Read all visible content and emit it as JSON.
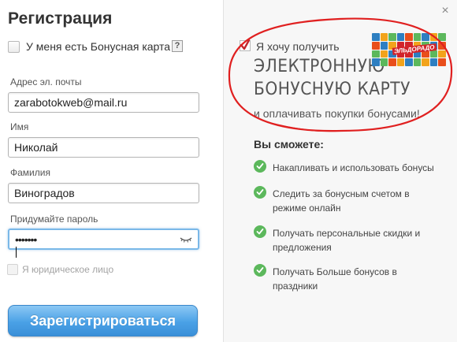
{
  "dialog": {
    "title": "Регистрация",
    "bonus_card_label": "У меня есть Бонусная карта",
    "help_badge": "?",
    "fields": [
      {
        "label": "Адрес эл. почты",
        "value": "zarabotokweb@mail.ru"
      },
      {
        "label": "Имя",
        "value": "Николай"
      },
      {
        "label": "Фамилия",
        "value": "Виноградов"
      },
      {
        "label": "Придумайте пароль",
        "value": "•••••••"
      }
    ],
    "legal_label": "Я юридическое лицо",
    "register_button": "Зарегистрироваться",
    "close_glyph": "×"
  },
  "promo": {
    "line1": "Я хочу получить",
    "big1": "ЭЛЕКТРОННУЮ",
    "big2": "БОНУСНУЮ КАРТУ",
    "line2": "и оплачивать покупки бонусами!",
    "logo_label": "ЭЛЬДОРАДО"
  },
  "benefits": {
    "title": "Вы сможете:",
    "items": [
      "Накапливать и использовать бонусы",
      "Следить за бонусным счетом в режиме онлайн",
      "Получать персональные скидки и предложения",
      "Получать Больше бонусов в праздники"
    ]
  },
  "colors": {
    "accent_blue": "#4aa1e6",
    "check_green": "#5cb85c",
    "annotation_red": "#e02020"
  },
  "icons": {
    "checkmark": "checkmark-icon",
    "eye": "eye-icon",
    "close": "close-icon"
  }
}
